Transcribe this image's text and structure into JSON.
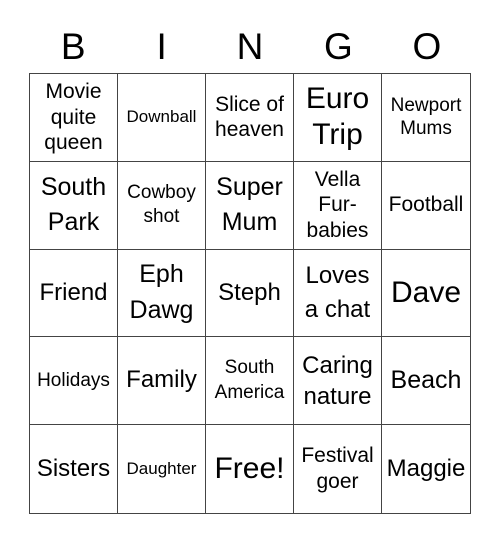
{
  "header": [
    "B",
    "I",
    "N",
    "G",
    "O"
  ],
  "cells": [
    {
      "text": "Movie quite queen"
    },
    {
      "text": "Downball"
    },
    {
      "text": "Slice of heaven"
    },
    {
      "text": "Euro Trip"
    },
    {
      "text": "Newport Mums"
    },
    {
      "text": "South Park"
    },
    {
      "text": "Cowboy shot"
    },
    {
      "text": "Super Mum"
    },
    {
      "text": "Vella Fur-babies"
    },
    {
      "text": "Football"
    },
    {
      "text": "Friend"
    },
    {
      "text": "Eph Dawg"
    },
    {
      "text": "Steph"
    },
    {
      "text": "Loves a chat"
    },
    {
      "text": "Dave"
    },
    {
      "text": "Holidays"
    },
    {
      "text": "Family"
    },
    {
      "text": "South America"
    },
    {
      "text": "Caring nature"
    },
    {
      "text": "Beach"
    },
    {
      "text": "Sisters"
    },
    {
      "text": "Daughter"
    },
    {
      "text": "Free!"
    },
    {
      "text": "Festival goer"
    },
    {
      "text": "Maggie"
    }
  ]
}
